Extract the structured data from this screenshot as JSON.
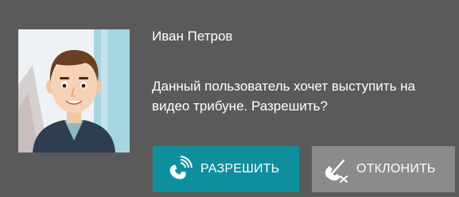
{
  "dialog": {
    "caller_name": "Иван Петров",
    "message": "Данный пользователь хочет выступить на видео трибуне. Разрешить?",
    "accept_label": "РАЗРЕШИТЬ",
    "decline_label": "ОТКЛОНИТЬ"
  },
  "icons": {
    "accept": "phone-ringing-icon",
    "decline": "phone-hangup-icon"
  },
  "colors": {
    "dialog_bg": "#5a5a5a",
    "accept_bg": "#0e8f9e",
    "decline_bg": "#8b8b8b",
    "text": "#ffffff"
  }
}
